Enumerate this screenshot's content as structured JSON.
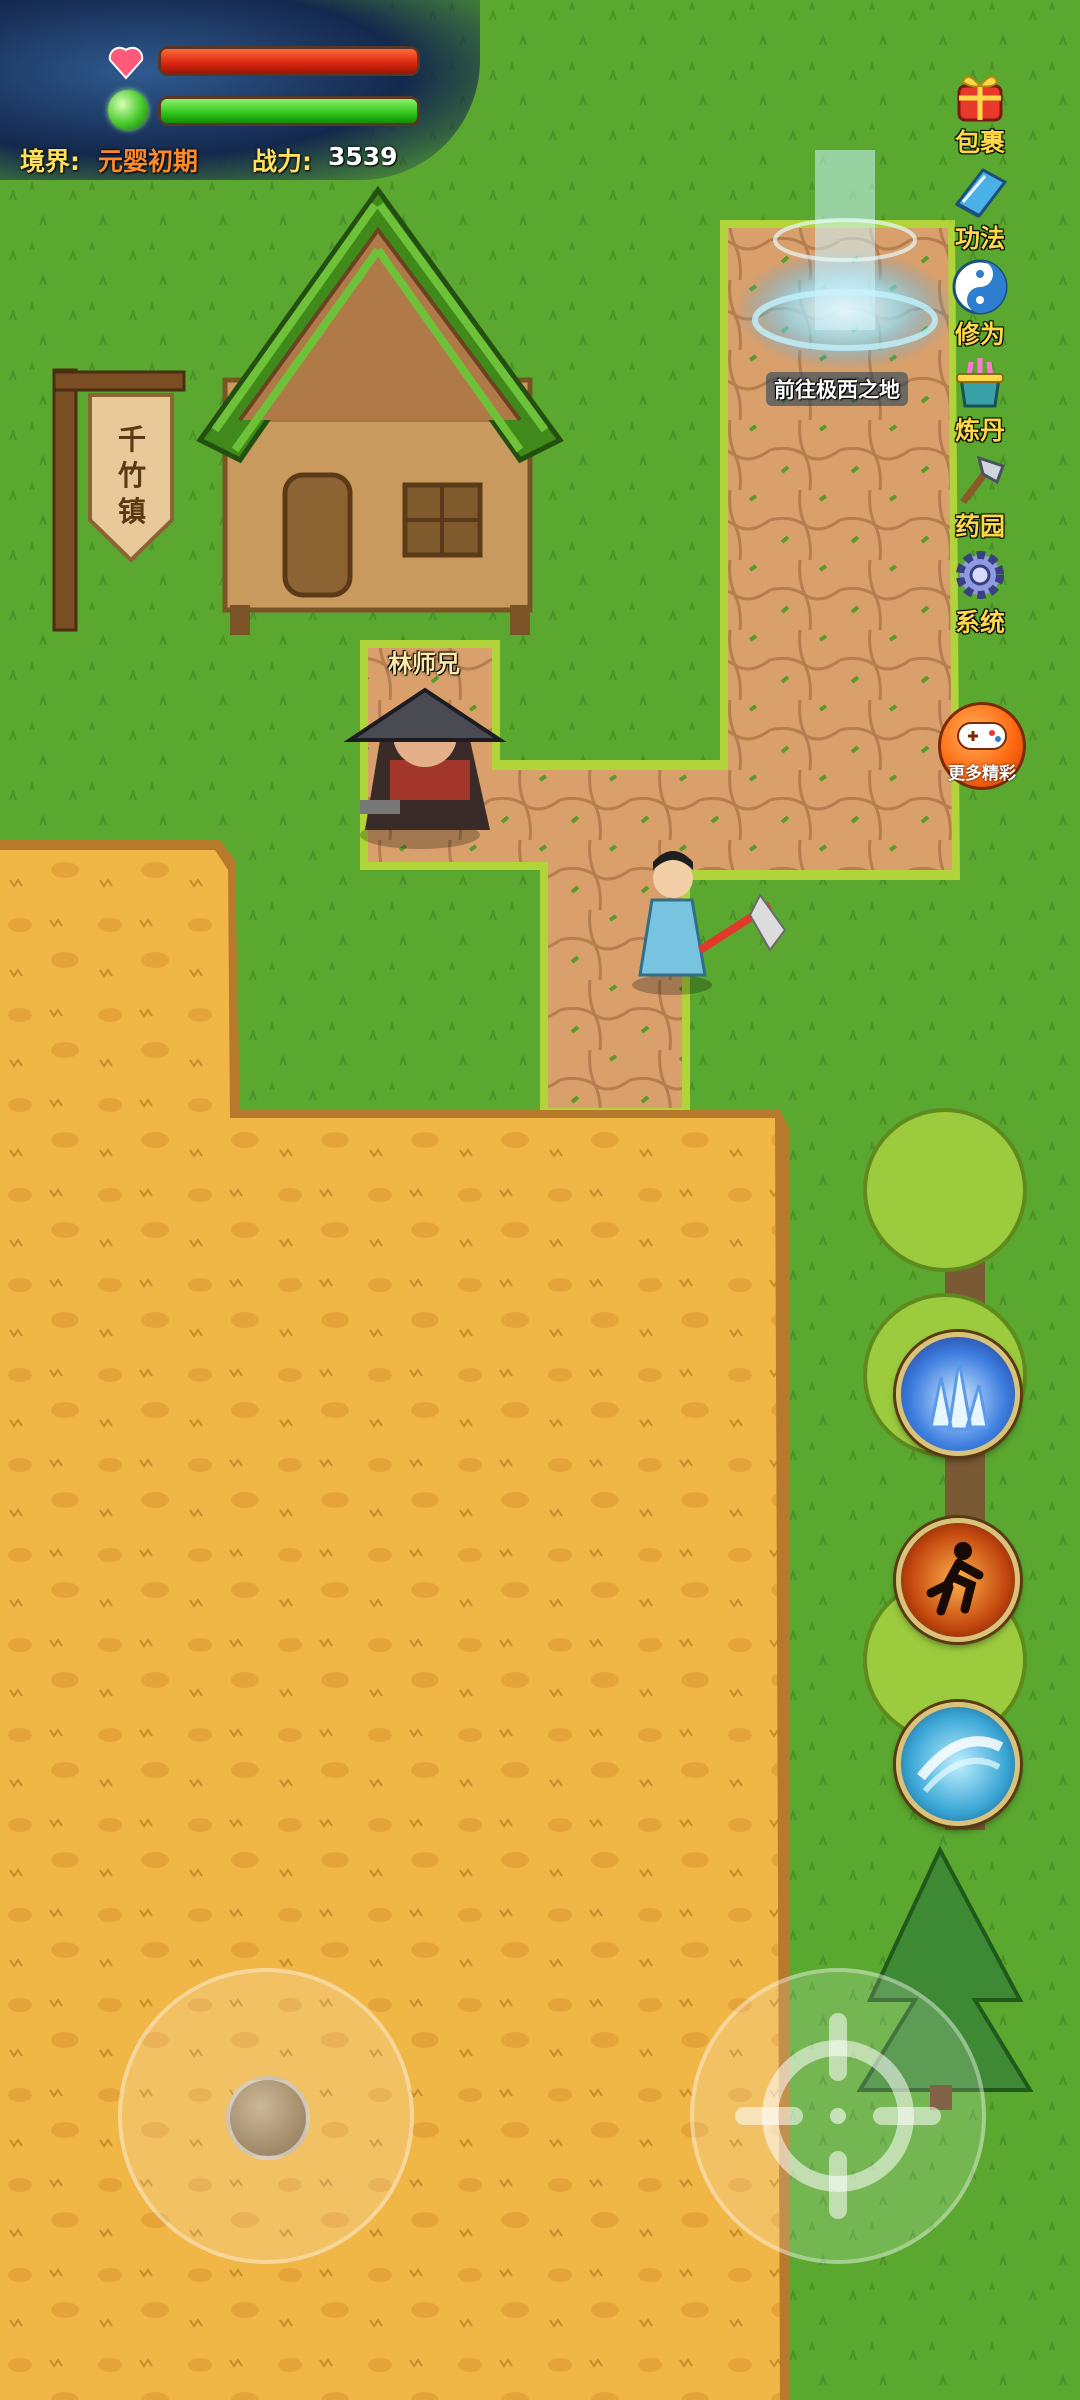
{
  "hud": {
    "hp_fill_percent": 100,
    "mp_fill_percent": 100,
    "realm_label": "境界:",
    "realm_value": "元婴初期",
    "power_label": "战力:",
    "power_value": "3539",
    "hp_color": "#d8260f",
    "mp_color": "#2ec419"
  },
  "map": {
    "town_sign": "千竹镇",
    "npc_name": "林师兄",
    "portal_label": "前往极西之地"
  },
  "menu": {
    "items": [
      {
        "label": "包裹",
        "icon": "gift-bag-icon"
      },
      {
        "label": "功法",
        "icon": "skill-book-icon"
      },
      {
        "label": "修为",
        "icon": "yin-yang-icon"
      },
      {
        "label": "炼丹",
        "icon": "cauldron-icon"
      },
      {
        "label": "药园",
        "icon": "hoe-icon"
      },
      {
        "label": "系统",
        "icon": "gear-icon"
      }
    ],
    "more_label": "更多精彩"
  },
  "skills": [
    {
      "icon": "ice-crystal-icon"
    },
    {
      "icon": "sprint-icon"
    },
    {
      "icon": "slash-icon"
    }
  ]
}
